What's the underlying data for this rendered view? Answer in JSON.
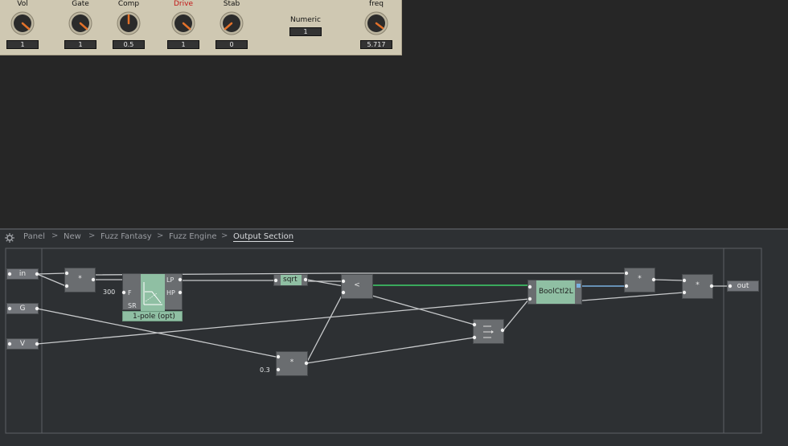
{
  "panel": {
    "knobs": [
      {
        "label": "Vol",
        "value": "1",
        "color": "#111111"
      },
      {
        "label": "Gate",
        "value": "1",
        "color": "#111111"
      },
      {
        "label": "Comp",
        "value": "0.5",
        "color": "#111111"
      },
      {
        "label": "Drive",
        "value": "1",
        "color": "#c21616"
      },
      {
        "label": "Stab",
        "value": "0",
        "color": "#111111"
      },
      {
        "label": "freq",
        "value": "5.717",
        "color": "#111111"
      }
    ],
    "numeric": {
      "label": "Numeric",
      "value": "1"
    }
  },
  "breadcrumb": {
    "items": [
      "Panel",
      "New",
      "Fuzz Fantasy",
      "Fuzz Engine",
      "Output Section"
    ],
    "separator": ">"
  },
  "modules": {
    "inputs": {
      "in": "in",
      "g": "G",
      "v": "V"
    },
    "output": "out",
    "multiply_symbol": "*",
    "filter": {
      "freq_const": "300",
      "port_f": "F",
      "port_sr": "SR",
      "port_lp": "LP",
      "port_hp": "HP",
      "name": "1-pole (opt)"
    },
    "sqrt": "sqrt",
    "compare_symbol": "<",
    "boolctl": "BoolCtl2L",
    "const_03": "0.3"
  },
  "colors": {
    "panel_bg": "#cfc8b2",
    "editor_bg": "#2d3033",
    "module_bg": "#6a6d70",
    "module_green": "#8fbfa3",
    "wire": "#c8cacc",
    "wire_green": "#3fd06a",
    "wire_blue": "#7ab0e0",
    "knob_indicator": "#e2712a"
  }
}
